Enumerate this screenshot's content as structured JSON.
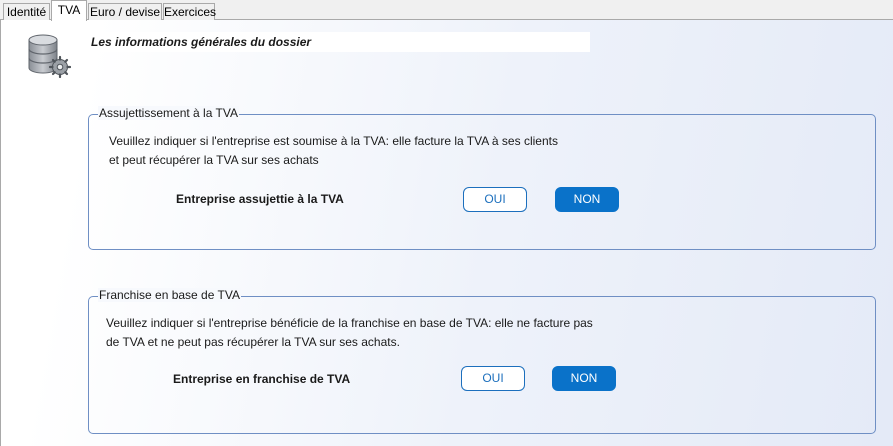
{
  "tabs": [
    {
      "label": "Identité"
    },
    {
      "label": "TVA"
    },
    {
      "label": "Euro / devise"
    },
    {
      "label": "Exercices"
    }
  ],
  "active_tab": "TVA",
  "header": {
    "title": "Les informations générales du dossier",
    "icon": "database-settings-icon"
  },
  "assujettissement": {
    "legend": "Assujettissement à la TVA",
    "description_line1": "Veuillez indiquer si l'entreprise est soumise à la TVA: elle facture la TVA à ses clients",
    "description_line2": "et peut récupérer la TVA sur ses achats",
    "question": "Entreprise assujettie à la TVA",
    "yes_label": "OUI",
    "no_label": "NON",
    "selected": "NON"
  },
  "franchise": {
    "legend": "Franchise en base de TVA",
    "description_line1": "Veuillez indiquer si l'entreprise bénéficie de la franchise en base de TVA: elle ne facture pas",
    "description_line2": "de TVA et ne peut pas récupérer la TVA sur ses achats.",
    "question": "Entreprise en franchise de TVA",
    "yes_label": "OUI",
    "no_label": "NON",
    "selected": "NON"
  },
  "colors": {
    "accent": "#0a72c9",
    "group_border": "#6f8fc4"
  }
}
